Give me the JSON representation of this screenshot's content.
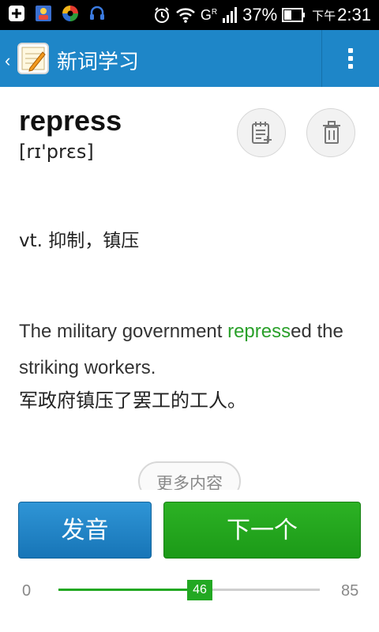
{
  "status_bar": {
    "battery": "37%",
    "time_prefix": "下午",
    "time": "2:31",
    "network": "G",
    "network_sup": "R"
  },
  "action_bar": {
    "title": "新词学习",
    "back_icon": "chevron-left-icon",
    "menu_icon": "more-vertical-icon"
  },
  "word": {
    "text": "repress",
    "phonetic": "[rɪ'prɛs]",
    "meaning": "vt. 抑制，镇压"
  },
  "example": {
    "before": "The military government ",
    "highlight": "repress",
    "after": "ed the striking workers.",
    "translation": "军政府镇压了罢工的工人。"
  },
  "more_label": "更多内容",
  "buttons": {
    "pronounce": "发音",
    "next": "下一个"
  },
  "slider": {
    "min": "0",
    "max": "85",
    "value": "46",
    "fraction": 0.541
  },
  "colors": {
    "action_bar": "#1e86c8",
    "highlight": "#2aa02a",
    "primary_button": "#1f80c2",
    "next_button": "#22a81e"
  }
}
